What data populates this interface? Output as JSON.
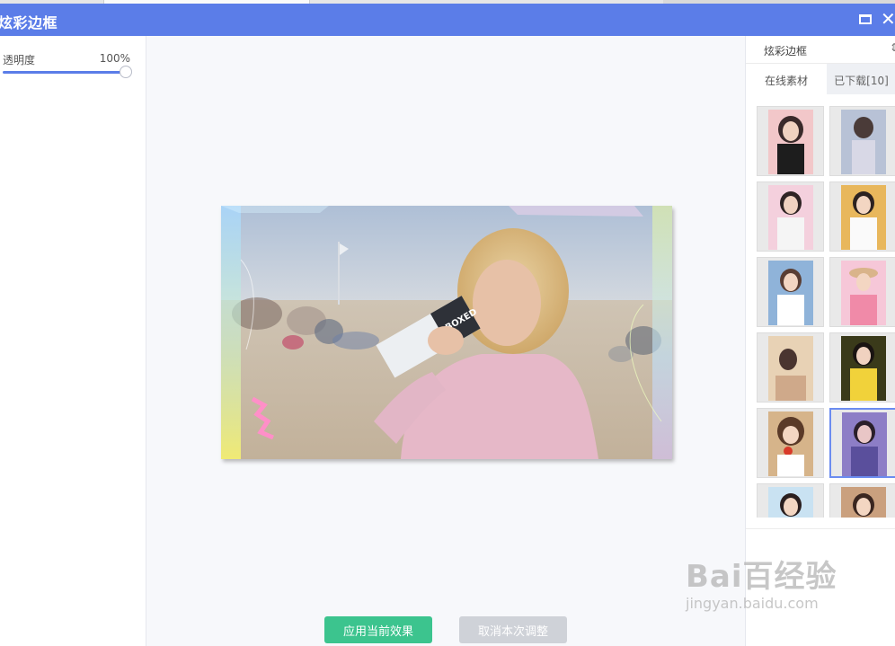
{
  "window": {
    "title": "炫彩边框"
  },
  "left_panel": {
    "opacity_label": "透明度",
    "opacity_value_text": "100%",
    "opacity_value": 1.0
  },
  "canvas": {
    "apply_button": "应用当前效果",
    "cancel_button": "取消本次调整"
  },
  "right_panel": {
    "title": "炫彩边框",
    "tabs": [
      {
        "label": "在线素材",
        "active": true
      },
      {
        "label": "已下载[10]",
        "active": false
      }
    ],
    "selected_thumbnail_index": 9,
    "thumbnail_count": 12
  },
  "watermark": {
    "brand": "Bai百经验",
    "url": "jingyan.baidu.com"
  },
  "colors": {
    "titlebar": "#5b7de8",
    "apply": "#3cc48e",
    "cancel": "#cfd2d8",
    "accent": "#5b7de8"
  }
}
